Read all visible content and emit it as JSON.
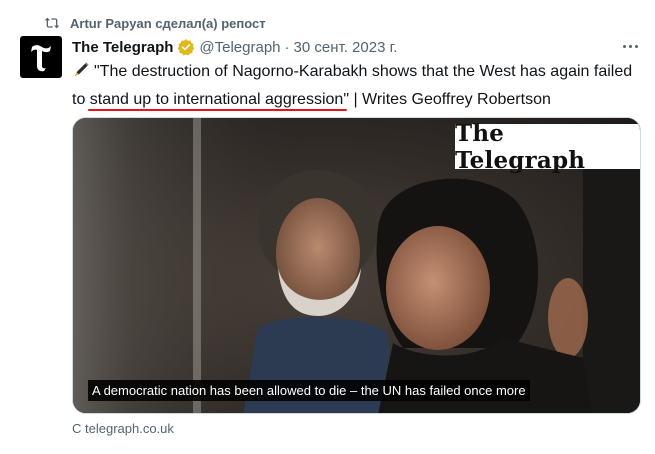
{
  "repost": {
    "icon": "repost-icon",
    "text": "Artur Papyan сделал(а) репост"
  },
  "tweet": {
    "avatar_icon": "telegraph-t-logo",
    "author_name": "The Telegraph",
    "verified_icon": "verified-gold-badge-icon",
    "handle": "@Telegraph",
    "separator": "·",
    "date": "30 сент. 2023 г.",
    "more_icon": "more-dots-icon",
    "pen_icon": "pen-icon",
    "text_part1": "\"The destruction of Nagorno-Karabakh shows that the West has again failed to ",
    "text_underlined": "stand up to international aggression",
    "text_part2": "\" | Writes Geoffrey Robertson"
  },
  "media": {
    "logo_text": "The Telegraph",
    "caption": "A democratic nation has been allowed to die – the UN has failed once more"
  },
  "card_source": "С telegraph.co.uk",
  "colors": {
    "text_primary": "#0f1419",
    "text_secondary": "#536471",
    "underline_red": "#e8141b",
    "verified_gold": "#e2b719",
    "border": "#cfd9de"
  }
}
